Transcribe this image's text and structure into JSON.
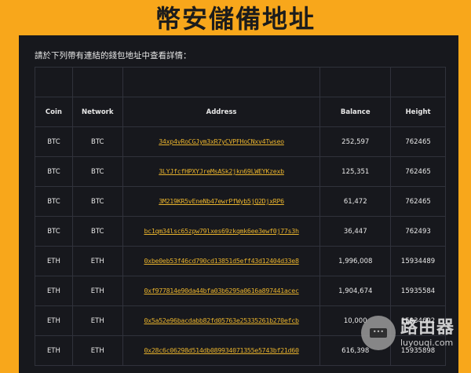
{
  "title": "幣安儲備地址",
  "subtitle": "請於下列帶有連結的錢包地址中查看詳情：",
  "table": {
    "headers": [
      "Coin",
      "Network",
      "Address",
      "Balance",
      "Height"
    ],
    "rows": [
      [
        "BTC",
        "BTC",
        "34xp4vRoCGJym3xR7yCVPFHoCNxv4Twseo",
        "252,597",
        "762465"
      ],
      [
        "BTC",
        "BTC",
        "3LYJfcfHPXYJreMsASk2jkn69LWEYKzexb",
        "125,351",
        "762465"
      ],
      [
        "BTC",
        "BTC",
        "3M219KR5vEneNb47ewrPfWyb5jQ2DjxRP6",
        "61,472",
        "762465"
      ],
      [
        "BTC",
        "BTC",
        "bc1qm34lsc65zpw79lxes69zkqmk6ee3ewf0j77s3h",
        "36,447",
        "762493"
      ],
      [
        "ETH",
        "ETH",
        "0xbe0eb53f46cd790cd13851d5eff43d12404d33e8",
        "1,996,008",
        "15934489"
      ],
      [
        "ETH",
        "ETH",
        "0xf977814e90da44bfa03b6295a0616a897441acec",
        "1,904,674",
        "15935584"
      ],
      [
        "ETH",
        "ETH",
        "0x5a52e96bacdabb82fd05763e25335261b270efcb",
        "10,000",
        "15934692"
      ],
      [
        "ETH",
        "ETH",
        "0x28c6c06298d514db089934071355e5743bf21d60",
        "616,398",
        "15935898"
      ]
    ]
  },
  "watermark": {
    "name": "路由器",
    "site": "luyouqi.com"
  },
  "colors": {
    "background": "#F8A71B",
    "panel": "#17181d",
    "link": "#E7B22D"
  }
}
